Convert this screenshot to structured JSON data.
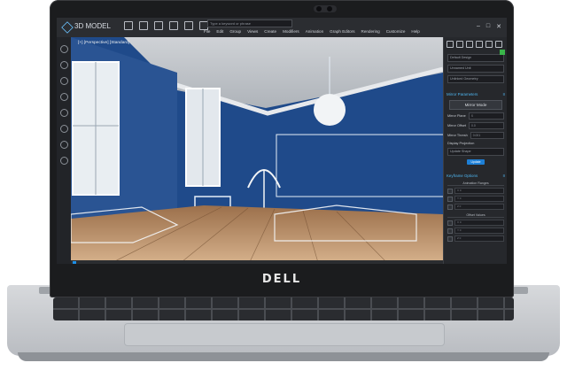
{
  "app": {
    "title": "3D MODEL",
    "search_placeholder": "Type a keyword or phrase",
    "menus": [
      "File",
      "Edit",
      "Group",
      "Views",
      "Create",
      "Modifiers",
      "Animation",
      "Graph Editors",
      "Rendering",
      "Customize",
      "Help"
    ],
    "window_controls": [
      "–",
      "□",
      "✕"
    ]
  },
  "viewport": {
    "label": "[+] [Perspective] [Standard]"
  },
  "right_panel": {
    "field1": "Default Design",
    "field2": "Unnamed Unit",
    "field3": "Unlinked Geometry",
    "swatch_color": "#3ab54a",
    "mirror_section": {
      "title": "Mirror Parameters",
      "button": "Mirror Mode",
      "props": [
        {
          "label": "Mirror Plane",
          "value": "X"
        },
        {
          "label": "Mirror Offset",
          "value": "0.0"
        },
        {
          "label": "Mirror Thresh",
          "value": "0.001"
        }
      ],
      "display_projection": "Display Projection",
      "mode_select": "Update Shape",
      "update_label": "Update"
    },
    "keyframe_section": {
      "title": "Keyframe Options",
      "group1": "Animation Ranges",
      "group1_rows": [
        "X 0",
        "Y 0",
        "Z 0"
      ],
      "group2": "Offset Values",
      "group2_rows": [
        "X 0",
        "Y 0",
        "Z 0"
      ]
    }
  },
  "laptop": {
    "brand": "DELL"
  }
}
